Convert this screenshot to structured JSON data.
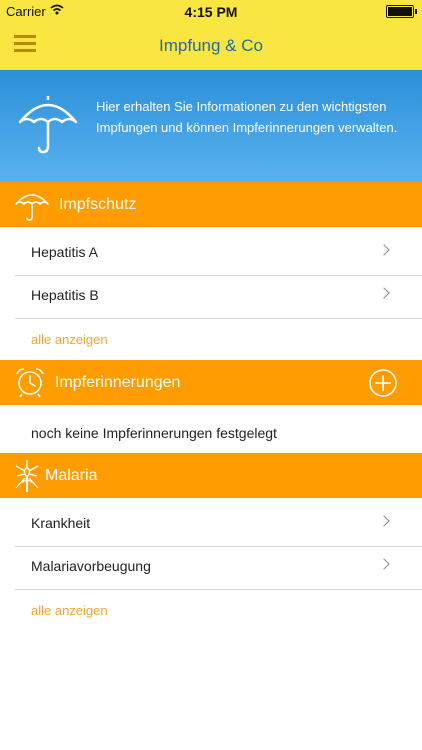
{
  "status": {
    "carrier": "Carrier",
    "time": "4:15 PM"
  },
  "nav": {
    "title": "Impfung & Co"
  },
  "hero": {
    "text": "Hier erhalten Sie Informationen zu den wichtigsten Impfungen und können Impferinnerungen verwalten."
  },
  "impfschutz": {
    "title": "Impfschutz",
    "items": [
      "Hepatitis A",
      "Hepatitis B"
    ],
    "show_all": "alle anzeigen"
  },
  "impferinnerungen": {
    "title": "Impferinnerungen",
    "empty": "noch keine Impferinnerungen festgelegt"
  },
  "malaria": {
    "title": "Malaria",
    "items": [
      "Krankheit",
      "Malariavorbeugung"
    ],
    "show_all": "alle anzeigen"
  },
  "colors": {
    "topbar": "#f9e641",
    "section": "#ff9d00",
    "hero_top": "#2b8fd8",
    "link": "#f3a52b"
  }
}
